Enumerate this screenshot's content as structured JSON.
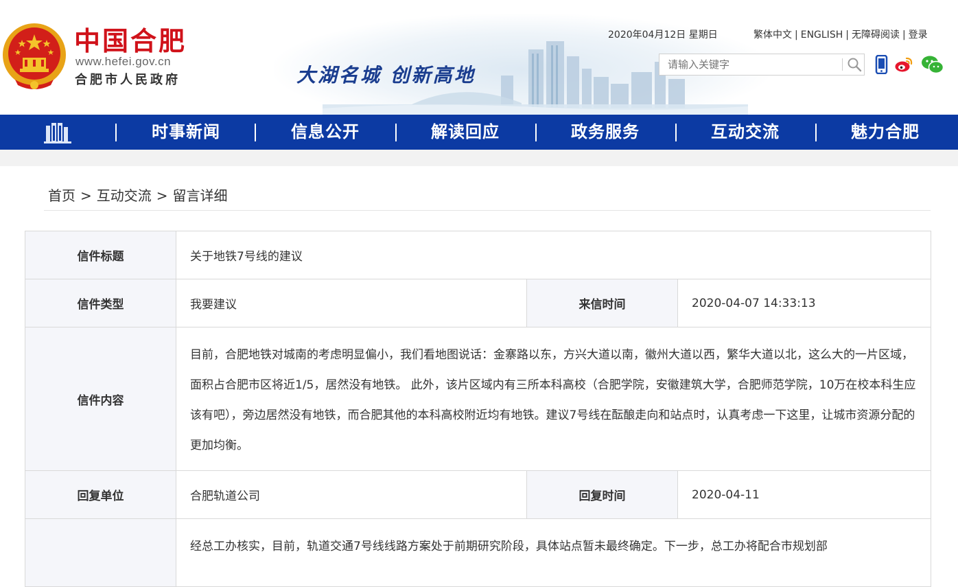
{
  "header": {
    "logo_title": "中国合肥",
    "logo_url": "www.hefei.gov.cn",
    "logo_subtitle": "合肥市人民政府",
    "slogan": "大湖名城  创新高地",
    "date": "2020年04月12日 星期日",
    "links": [
      "繁体中文",
      "ENGLISH",
      "无障碍阅读",
      "登录"
    ],
    "search_placeholder": "请输入关键字",
    "accent_red": "#d0121a",
    "accent_blue": "#0c3aa3"
  },
  "nav": {
    "items": [
      "时事新闻",
      "信息公开",
      "解读回应",
      "政务服务",
      "互动交流",
      "魅力合肥"
    ]
  },
  "breadcrumb": [
    "首页",
    "互动交流",
    "留言详细"
  ],
  "letter": {
    "title_label": "信件标题",
    "title": "关于地铁7号线的建议",
    "type_label": "信件类型",
    "type": "我要建议",
    "time_label": "来信时间",
    "time": "2020-04-07 14:33:13",
    "content_label": "信件内容",
    "content": "目前，合肥地铁对城南的考虑明显偏小，我们看地图说话：金寨路以东，方兴大道以南，徽州大道以西，繁华大道以北，这么大的一片区域，面积占合肥市区将近1/5，居然没有地铁。 此外，该片区域内有三所本科高校（合肥学院，安徽建筑大学，合肥师范学院，10万在校本科生应该有吧），旁边居然没有地铁，而合肥其他的本科高校附近均有地铁。建议7号线在酝酿走向和站点时，认真考虑一下这里，让城市资源分配的更加均衡。",
    "reply_unit_label": "回复单位",
    "reply_unit": "合肥轨道公司",
    "reply_time_label": "回复时间",
    "reply_time": "2020-04-11",
    "reply_content": "经总工办核实，目前，轨道交通7号线线路方案处于前期研究阶段，具体站点暂未最终确定。下一步，总工办将配合市规划部"
  }
}
